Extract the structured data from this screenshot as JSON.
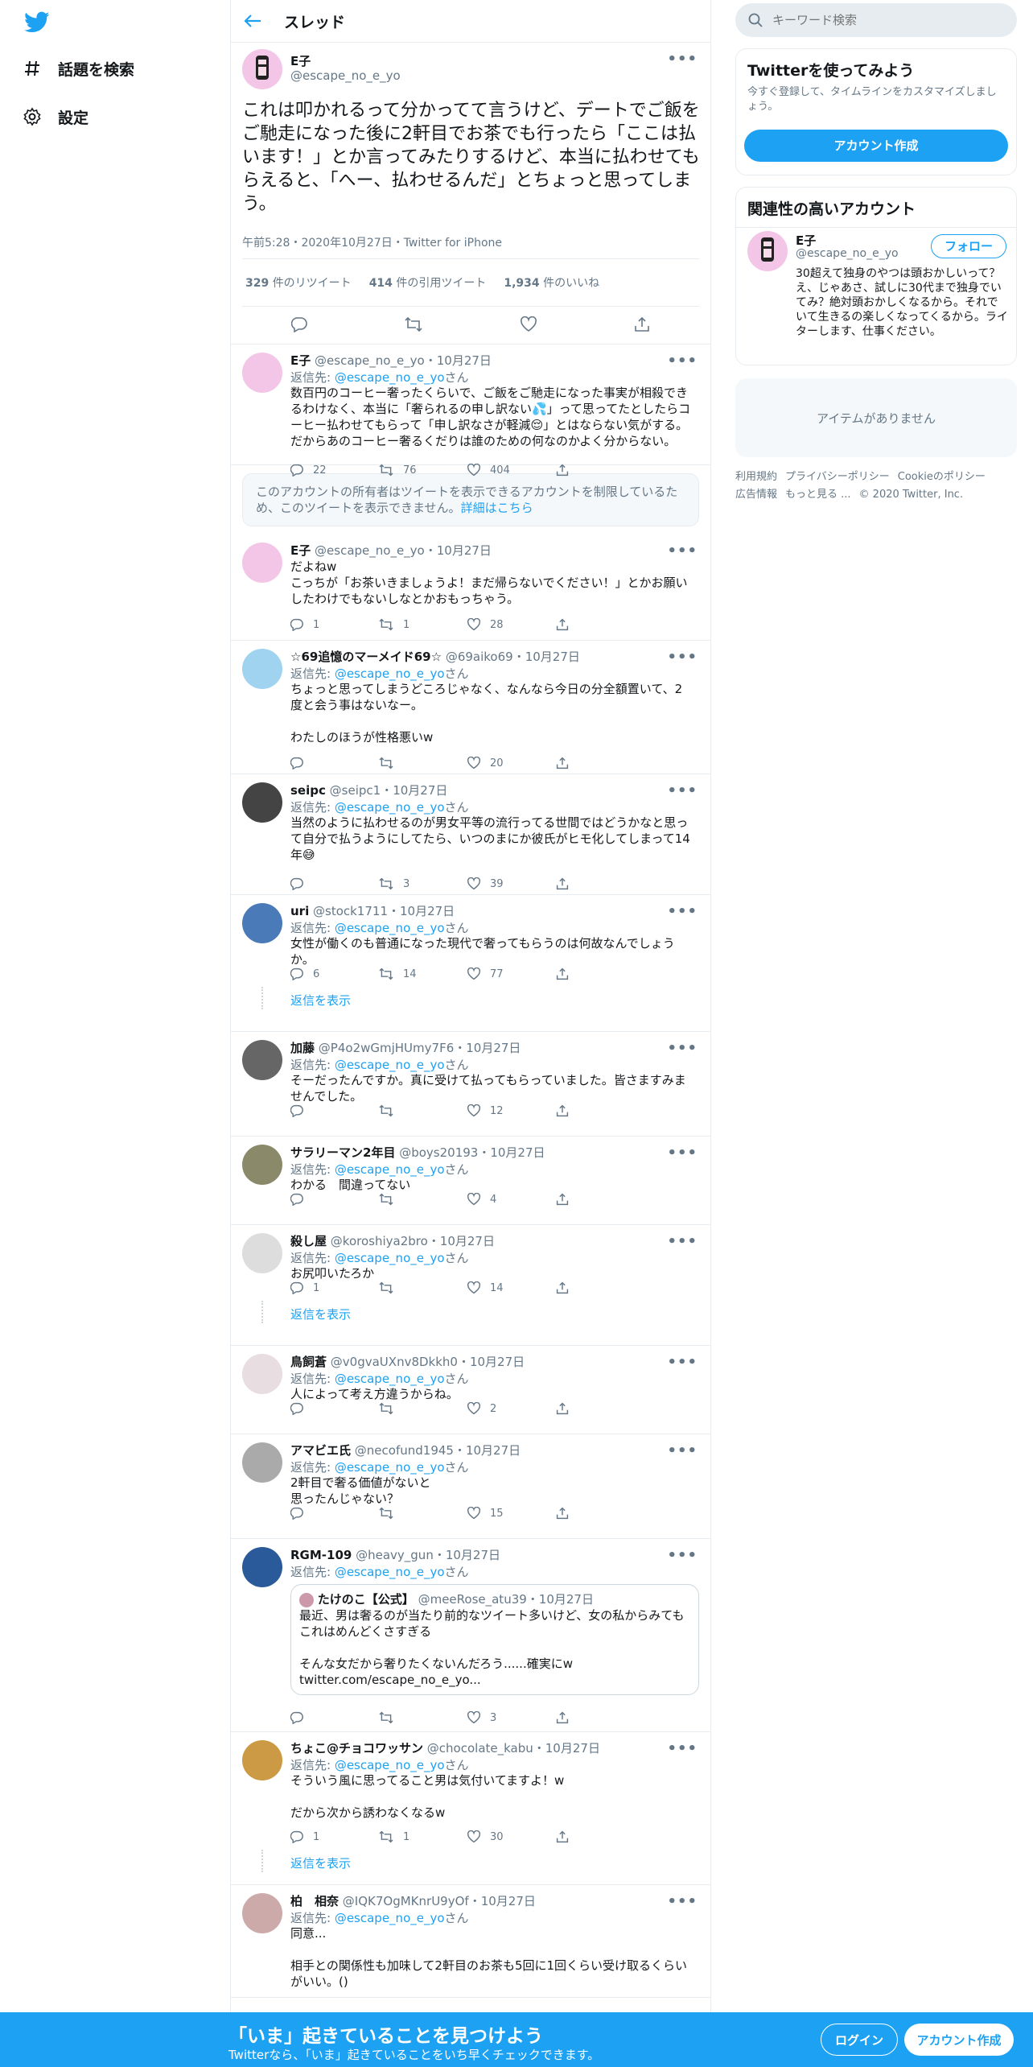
{
  "nav": {
    "explore": "話題を検索",
    "settings": "設定"
  },
  "header": {
    "title": "スレッド"
  },
  "main_tweet": {
    "name": "E子",
    "handle": "@escape_no_e_yo",
    "text": "これは叩かれるって分かってて言うけど、デートでご飯をご馳走になった後に2軒目でお茶でも行ったら「ここは払います！」とか言ってみたりするけど、本当に払わせてもらえると、「へー、払わせるんだ」とちょっと思ってしまう。",
    "meta": "午前5:28・2020年10月27日・Twitter for iPhone",
    "retweets": "329",
    "retweets_label": "件のリツイート",
    "quotes": "414",
    "quotes_label": "件の引用ツイート",
    "likes": "1,934",
    "likes_label": "件のいいね"
  },
  "reply_to_label": "返信先: ",
  "reply_to_handle": "@escape_no_e_yo",
  "reply_to_suffix": "さん",
  "show_replies": "返信を表示",
  "notice": {
    "text": "このアカウントの所有者はツイートを表示できるアカウントを制限しているため、このツイートを表示できません。",
    "link": "詳細はこちら"
  },
  "replies": [
    {
      "name": "E子",
      "handle": "@escape_no_e_yo",
      "date": "・10月27日",
      "text": "数百円のコーヒー奢ったくらいで、ご飯をご馳走になった事実が相殺できるわけなく、本当に「奢られるの申し訳ない💦」って思ってたとしたらコーヒー払わせてもらって「申し訳なさが軽減😌」とはならない気がする。だからあのコーヒー奢るくだりは誰のための何なのかよく分からない。",
      "reply": "22",
      "rt": "76",
      "like": "404"
    },
    {
      "name": "E子",
      "handle": "@escape_no_e_yo",
      "date": "・10月27日",
      "text": "だよねw\nこっちが「お茶いきましょうよ！まだ帰らないでください！」とかお願いしたわけでもないしなとかおもっちゃう。",
      "reply": "1",
      "rt": "1",
      "like": "28"
    },
    {
      "name": "☆69追憶のマーメイド69☆",
      "handle": "@69aiko69",
      "date": "・10月27日",
      "text": "ちょっと思ってしまうどころじゃなく、なんなら今日の分全額置いて、2度と会う事はないなー。\n\nわたしのほうが性格悪いw",
      "reply": "",
      "rt": "",
      "like": "20"
    },
    {
      "name": "seipc",
      "handle": "@seipc1",
      "date": "・10月27日",
      "text": "当然のように払わせるのが男女平等の流行ってる世間ではどうかなと思って自分で払うようにしてたら、いつのまにか彼氏がヒモ化してしまって14年😅",
      "reply": "",
      "rt": "3",
      "like": "39"
    },
    {
      "name": "uri",
      "handle": "@stock1711",
      "date": "・10月27日",
      "text": "女性が働くのも普通になった現代で奢ってもらうのは何故なんでしょうか。",
      "reply": "6",
      "rt": "14",
      "like": "77"
    },
    {
      "name": "加藤",
      "handle": "@P4o2wGmjHUmy7F6",
      "date": "・10月27日",
      "text": "そーだったんですか。真に受けて払ってもらっていました。皆さますみませんでした。",
      "reply": "",
      "rt": "",
      "like": "12"
    },
    {
      "name": "サラリーマン2年目",
      "handle": "@boys20193",
      "date": "・10月27日",
      "text": "わかる　間違ってない",
      "reply": "",
      "rt": "",
      "like": "4"
    },
    {
      "name": "殺し屋",
      "handle": "@koroshiya2bro",
      "date": "・10月27日",
      "text": "お尻叩いたろか",
      "reply": "1",
      "rt": "",
      "like": "14"
    },
    {
      "name": "鳥飼蒼",
      "handle": "@v0gvaUXnv8Dkkh0",
      "date": "・10月27日",
      "text": "人によって考え方違うからね。",
      "reply": "",
      "rt": "",
      "like": "2"
    },
    {
      "name": "アマビエ氏",
      "handle": "@necofund1945",
      "date": "・10月27日",
      "text": "2軒目で奢る価値がないと\n思ったんじゃない？",
      "reply": "",
      "rt": "",
      "like": "15"
    },
    {
      "name": "RGM-109",
      "handle": "@heavy_gun",
      "date": "・10月27日",
      "text": "",
      "reply": "",
      "rt": "",
      "like": "3"
    },
    {
      "name": "ちょこ@チョコワッサン",
      "handle": "@chocolate_kabu",
      "date": "・10月27日",
      "text": "そういう風に思ってること男は気付いてますよ！w\n\nだから次から誘わなくなるw",
      "reply": "1",
      "rt": "1",
      "like": "30"
    },
    {
      "name": "柏　相奈",
      "handle": "@IQK7OgMKnrU9yOf",
      "date": "・10月27日",
      "text": "同意...\n\n相手との関係性も加味して2軒目のお茶も5回に1回くらい受け取るくらいがいい。()",
      "reply": "",
      "rt": "",
      "like": ""
    }
  ],
  "quote": {
    "name": "たけのこ【公式】",
    "handle": "@meeRose_atu39",
    "date": "・10月27日",
    "text": "最近、男は奢るのが当たり前的なツイート多いけど、女の私からみてもこれはめんどくさすぎる\n\nそんな女だから奢りたくないんだろう......確実にw\ntwitter.com/escape_no_e_yo..."
  },
  "search": {
    "placeholder": "キーワード検索"
  },
  "signup_card": {
    "title": "Twitterを使ってみよう",
    "sub": "今すぐ登録して、タイムラインをカスタマイズしましょう。",
    "button": "アカウント作成"
  },
  "related": {
    "title": "関連性の高いアカウント",
    "name": "E子",
    "handle": "@escape_no_e_yo",
    "follow": "フォロー",
    "bio": "30超えて独身のやつは頭おかしいって？え、じゃあさ、試しに30代まで独身でいてみ？絶対頭おかしくなるから。それでいて生きるの楽しくなってくるから。ライターします、仕事ください。"
  },
  "trends": {
    "empty": "アイテムがありません"
  },
  "footer": {
    "l1": "利用規約",
    "l2": "プライバシーポリシー",
    "l3": "Cookieのポリシー",
    "l4": "広告情報",
    "l5": "もっと見る ...",
    "copy": "© 2020 Twitter, Inc."
  },
  "bottom_bar": {
    "title": "「いま」起きていることを見つけよう",
    "sub": "Twitterなら、「いま」起きていることをいち早くチェックできます。",
    "login": "ログイン",
    "signup": "アカウント作成"
  },
  "colors": {
    "accent": "#1da1f2",
    "muted": "#657786"
  }
}
